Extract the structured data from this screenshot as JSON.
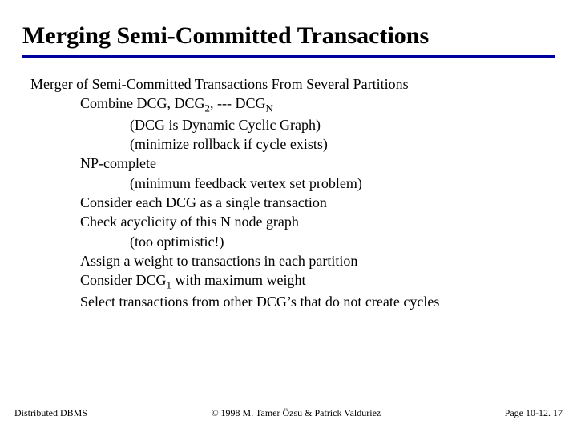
{
  "title": "Merging Semi-Committed Transactions",
  "lines": {
    "l0": "Merger of Semi-Committed Transactions From Several Partitions",
    "l1a": "Combine DCG, DCG",
    "l1b": ", --- DCG",
    "sub2": "2",
    "subN": "N",
    "l2": "(DCG is Dynamic Cyclic Graph)",
    "l3": "(minimize rollback if cycle exists)",
    "l4": "NP-complete",
    "l5": "(minimum feedback vertex set problem)",
    "l6": "Consider each DCG as a single transaction",
    "l7": "Check acyclicity of this N node graph",
    "l8": "(too optimistic!)",
    "l9": "Assign a weight to transactions in each partition",
    "l10a": "Consider DCG",
    "sub1": "1",
    "l10b": " with maximum weight",
    "l11": "Select transactions from other DCG’s that do not create cycles"
  },
  "footer": {
    "left": "Distributed DBMS",
    "center": "© 1998 M. Tamer Özsu & Patrick Valduriez",
    "right": "Page 10-12. 17"
  }
}
